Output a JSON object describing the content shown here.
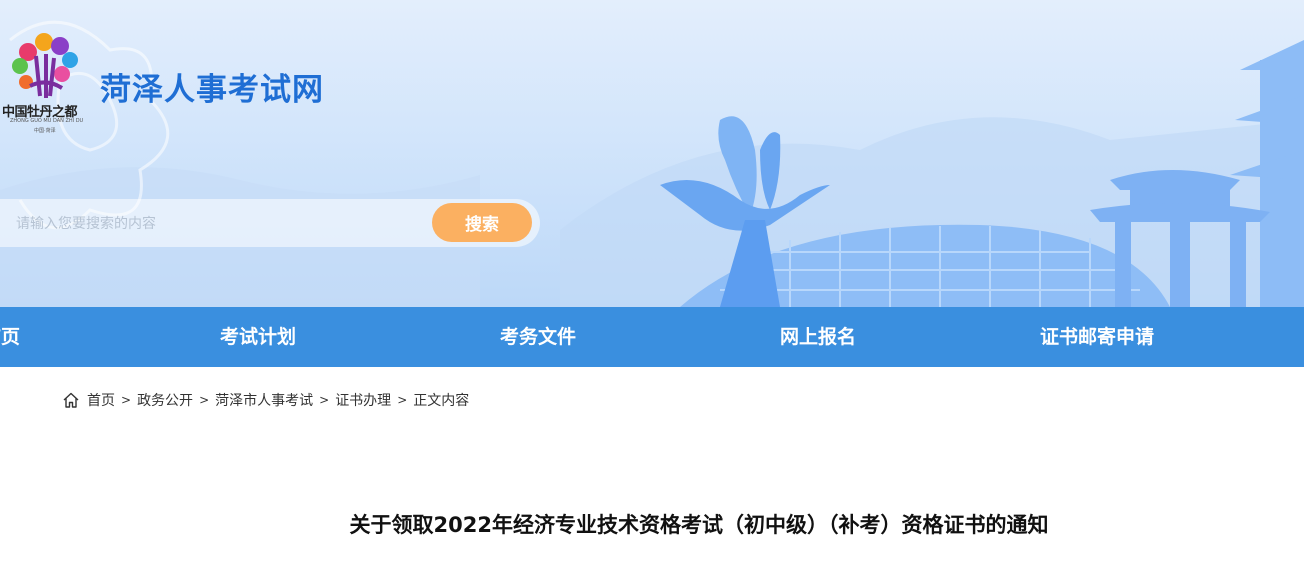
{
  "site": {
    "title": "菏泽人事考试网",
    "logo_text": "中国牡丹之都",
    "logo_pinyin": "ZHONG GUO MU DAN ZHI DU",
    "logo_sub": "中国·菏泽"
  },
  "search": {
    "placeholder": "请输入您要搜索的内容",
    "button_label": "搜索"
  },
  "nav": {
    "items": [
      {
        "label": "首页"
      },
      {
        "label": "考试计划"
      },
      {
        "label": "考务文件"
      },
      {
        "label": "网上报名"
      },
      {
        "label": "证书邮寄申请"
      }
    ]
  },
  "breadcrumb": {
    "items": [
      "首页",
      "政务公开",
      "菏泽市人事考试",
      "证书办理",
      "正文内容"
    ],
    "separator": ">"
  },
  "article": {
    "title": "关于领取2022年经济专业技术资格考试（初中级）（补考）资格证书的通知"
  },
  "colors": {
    "brand_blue": "#1f6ed4",
    "nav_blue": "#3a8fdf",
    "search_button": "#fbb061"
  },
  "icons": {
    "breadcrumb_home": "home-icon",
    "logo": "peony-logo"
  }
}
